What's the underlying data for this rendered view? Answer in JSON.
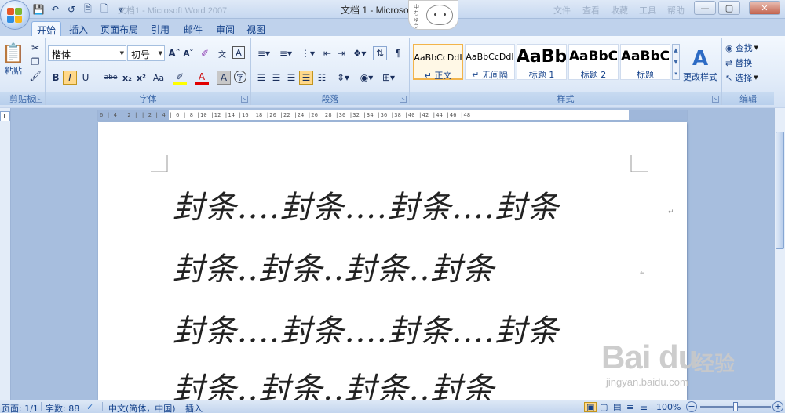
{
  "window": {
    "title": "文档 1 - Microso",
    "faded_left": "文档1 - Microsoft Word 2007",
    "faded_right": [
      "文件",
      "查看",
      "收藏",
      "工具",
      "帮助"
    ]
  },
  "qat": {
    "save": "save",
    "undo": "undo",
    "redo": "redo"
  },
  "sticker": {
    "side_text": "中ちゅう"
  },
  "tabs": [
    "开始",
    "插入",
    "页面布局",
    "引用",
    "邮件",
    "审阅",
    "视图"
  ],
  "ribbon": {
    "clipboard": {
      "paste_label": "粘贴",
      "group_label": "剪贴板"
    },
    "font": {
      "font_name": "楷体",
      "font_size": "初号",
      "group_label": "字体",
      "buttons": [
        "B",
        "I",
        "U",
        "abe",
        "x₂",
        "x²",
        "Aa",
        "A",
        "A",
        "字"
      ]
    },
    "paragraph": {
      "group_label": "段落"
    },
    "styles": {
      "group_label": "样式",
      "cards": [
        {
          "sample": "AaBbCcDdI",
          "name": "↵ 正文"
        },
        {
          "sample": "AaBbCcDdI",
          "name": "↵ 无间隔"
        },
        {
          "sample": "AaBb",
          "name": "标题 1"
        },
        {
          "sample": "AaBbC",
          "name": "标题 2"
        },
        {
          "sample": "AaBbC",
          "name": "标题"
        }
      ],
      "change_label": "更改样式"
    },
    "editing": {
      "find": "查找",
      "replace": "替换",
      "select": "选择",
      "group_label": "编辑"
    }
  },
  "ruler": {
    "corner": "L",
    "h_numbers": "6 | 4 | 2 |     | 2 | 4 | 6 | 8 |10 |12 |14 |16 |18 |20 |22 |24 |26 |28 |30 |32 |34 |36 |38 |40 |42 |44 |46 |48"
  },
  "document": {
    "lines": [
      "封条....封条....封条....封条",
      "封条..封条..封条..封条",
      "封条....封条....封条....封条",
      "封条..封条..封条..封条"
    ],
    "paragraph_mark": "↵"
  },
  "watermark": {
    "brand": "Bai du",
    "cn": "经验",
    "sub": "jingyan.baidu.com"
  },
  "status": {
    "page": "页面: 1/1",
    "words": "字数: 88",
    "lang": "中文(简体，中国)",
    "mode": "插入",
    "zoom": "100%"
  }
}
